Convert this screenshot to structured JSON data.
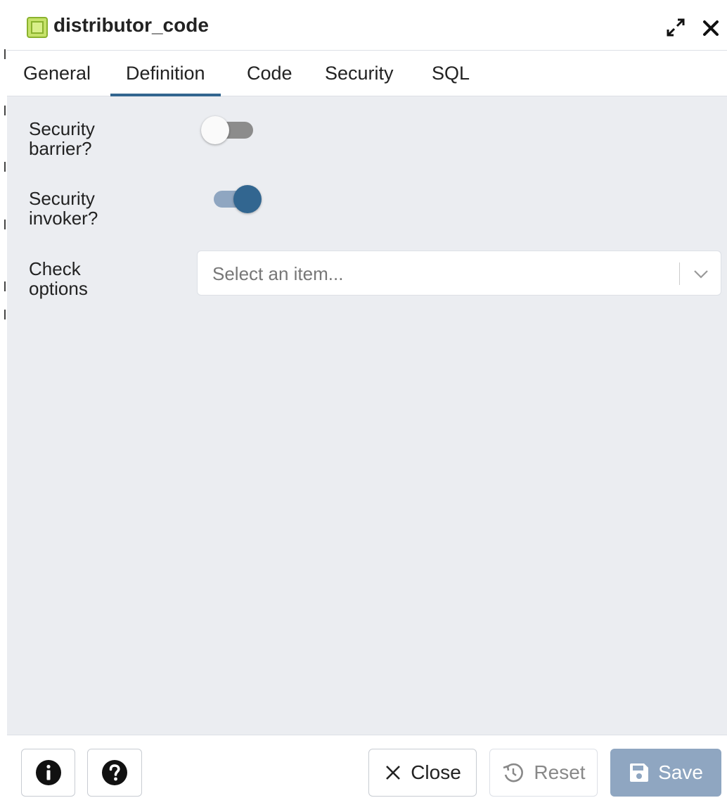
{
  "window": {
    "title": "distributor_code",
    "icon": "view-icon"
  },
  "tabs": [
    {
      "label": "General",
      "active": false
    },
    {
      "label": "Definition",
      "active": true
    },
    {
      "label": "Code",
      "active": false
    },
    {
      "label": "Security",
      "active": false
    },
    {
      "label": "SQL",
      "active": false
    }
  ],
  "form": {
    "security_barrier": {
      "label_line1": "Security",
      "label_line2": "barrier?",
      "value": false
    },
    "security_invoker": {
      "label_line1": "Security",
      "label_line2": "invoker?",
      "value": true
    },
    "check_options": {
      "label_line1": "Check",
      "label_line2": "options",
      "placeholder": "Select an item..."
    }
  },
  "footer": {
    "info_icon": "info-icon",
    "help_icon": "help-icon",
    "close_label": "Close",
    "reset_label": "Reset",
    "save_label": "Save"
  },
  "colors": {
    "accent": "#326690",
    "save_disabled": "#8fa6c1",
    "body_bg": "#ebedf1",
    "icon_green": "#c6e26a"
  }
}
